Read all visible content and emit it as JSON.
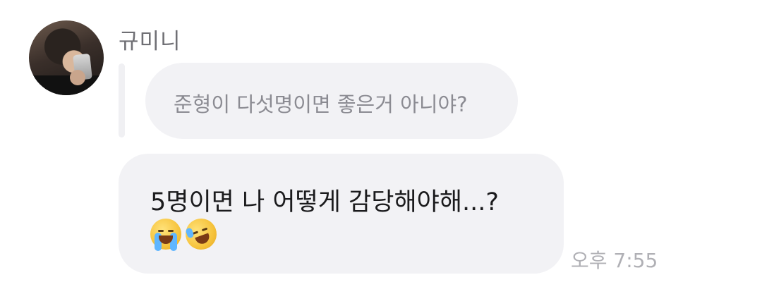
{
  "sender": {
    "name": "규미니"
  },
  "reply": {
    "text": "준형이 다섯명이면 좋은거 아니야?"
  },
  "message": {
    "text": "5명이면 나 어떻게 감당해야해...?",
    "emojis": [
      "loudly-crying-face-icon",
      "rolling-on-the-floor-laughing-icon"
    ]
  },
  "time": "오후 7:55"
}
